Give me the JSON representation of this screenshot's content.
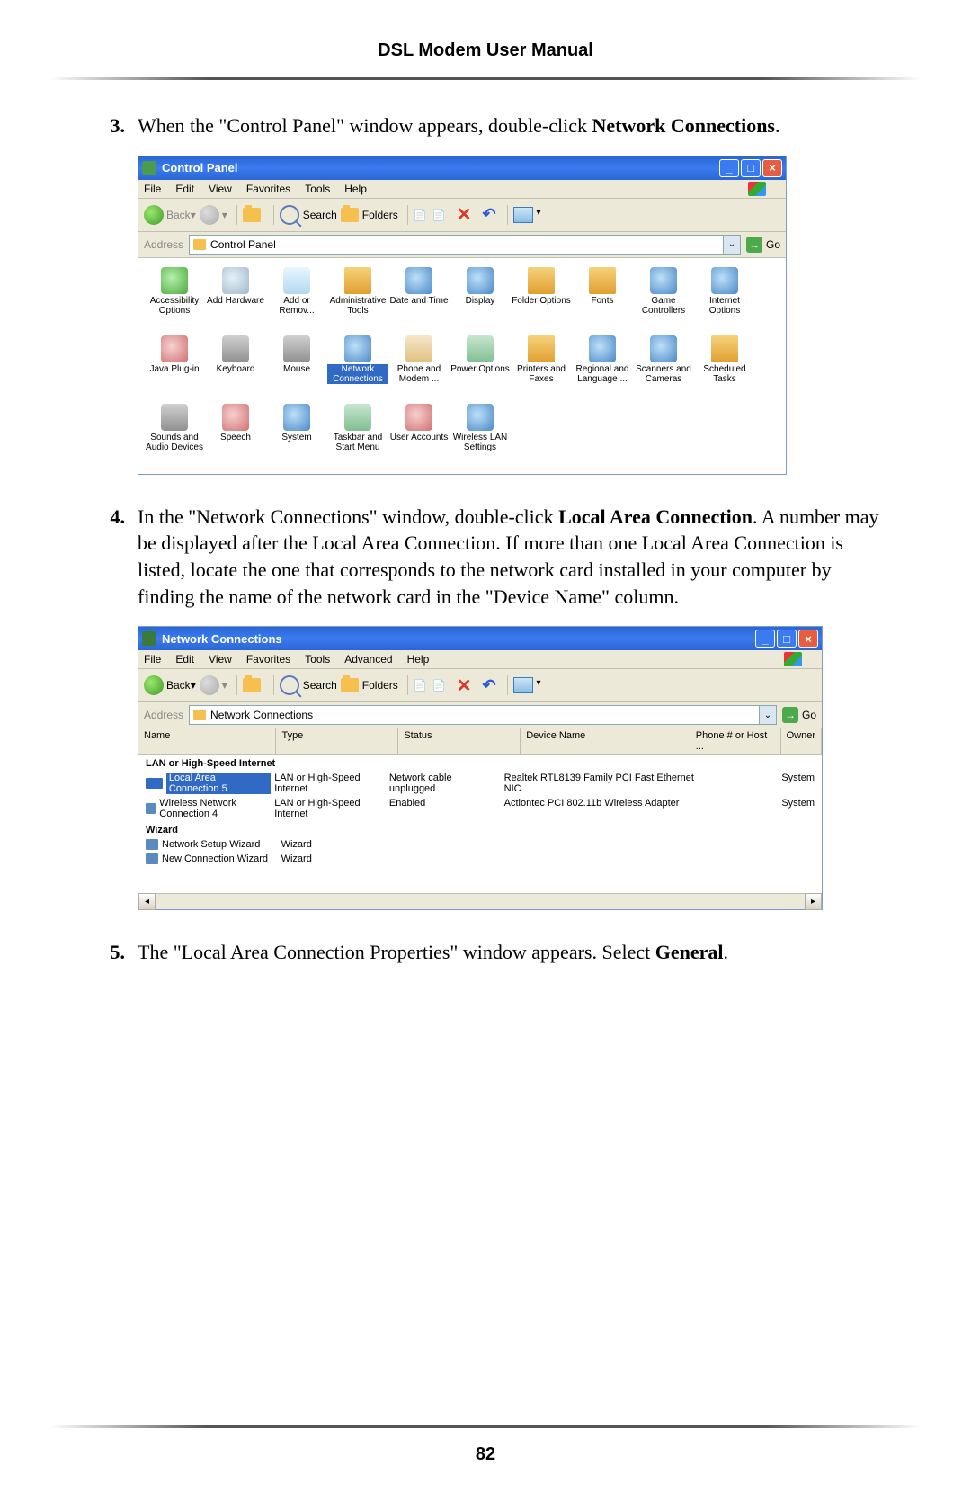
{
  "header": {
    "title": "DSL Modem User Manual"
  },
  "steps": {
    "s3": {
      "num": "3.",
      "pre": "When the \"Control Panel\" window appears, double-click ",
      "bold": "Network Connections",
      "post": "."
    },
    "s4": {
      "num": "4.",
      "pre": "In the \"Network Connections\" window, double-click ",
      "bold": "Local Area Connection",
      "post": ". A number may be displayed after the Local Area Connection. If more than one Local Area Connection is listed, locate the one that corresponds to the network card installed in your computer by finding the name of the network card in the \"Device Name\" column."
    },
    "s5": {
      "num": "5.",
      "pre": "The \"Local Area Connection Properties\" window appears. Select ",
      "bold": "General",
      "post": "."
    }
  },
  "cp": {
    "title": "Control Panel",
    "menu": {
      "file": "File",
      "edit": "Edit",
      "view": "View",
      "fav": "Favorites",
      "tools": "Tools",
      "help": "Help"
    },
    "toolbar": {
      "back": "Back",
      "search": "Search",
      "folders": "Folders"
    },
    "addr": {
      "label": "Address",
      "value": "Control Panel",
      "go": "Go"
    },
    "items": [
      {
        "label": "Accessibility Options",
        "c": "c1"
      },
      {
        "label": "Add Hardware",
        "c": "c2"
      },
      {
        "label": "Add or Remov...",
        "c": "c3"
      },
      {
        "label": "Administrative Tools",
        "c": "c4"
      },
      {
        "label": "Date and Time",
        "c": "c5"
      },
      {
        "label": "Display",
        "c": "c5"
      },
      {
        "label": "Folder Options",
        "c": "c4"
      },
      {
        "label": "Fonts",
        "c": "c4"
      },
      {
        "label": "Game Controllers",
        "c": "c5"
      },
      {
        "label": "Internet Options",
        "c": "c5"
      },
      {
        "label": "Java Plug-in",
        "c": "c8"
      },
      {
        "label": "Keyboard",
        "c": "c6"
      },
      {
        "label": "Mouse",
        "c": "c6"
      },
      {
        "label": "Network Connections",
        "c": "c5",
        "sel": true
      },
      {
        "label": "Phone and Modem ...",
        "c": "c7"
      },
      {
        "label": "Power Options",
        "c": "c9"
      },
      {
        "label": "Printers and Faxes",
        "c": "c4"
      },
      {
        "label": "Regional and Language ...",
        "c": "c5"
      },
      {
        "label": "Scanners and Cameras",
        "c": "c5"
      },
      {
        "label": "Scheduled Tasks",
        "c": "c4"
      },
      {
        "label": "Sounds and Audio Devices",
        "c": "c6"
      },
      {
        "label": "Speech",
        "c": "c8"
      },
      {
        "label": "System",
        "c": "c5"
      },
      {
        "label": "Taskbar and Start Menu",
        "c": "c9"
      },
      {
        "label": "User Accounts",
        "c": "c8"
      },
      {
        "label": "Wireless LAN Settings",
        "c": "c5"
      }
    ]
  },
  "nc": {
    "title": "Network Connections",
    "menu": {
      "file": "File",
      "edit": "Edit",
      "view": "View",
      "fav": "Favorites",
      "tools": "Tools",
      "adv": "Advanced",
      "help": "Help"
    },
    "toolbar": {
      "back": "Back",
      "search": "Search",
      "folders": "Folders"
    },
    "addr": {
      "label": "Address",
      "value": "Network Connections",
      "go": "Go"
    },
    "cols": {
      "name": "Name",
      "type": "Type",
      "status": "Status",
      "dev": "Device Name",
      "phone": "Phone # or Host ...",
      "owner": "Owner"
    },
    "group1": "LAN or High-Speed Internet",
    "rows1": [
      {
        "name": "Local Area Connection 5",
        "type": "LAN or High-Speed Internet",
        "status": "Network cable unplugged",
        "dev": "Realtek RTL8139 Family PCI Fast Ethernet NIC",
        "owner": "System",
        "sel": true
      },
      {
        "name": "Wireless Network Connection 4",
        "type": "LAN or High-Speed Internet",
        "status": "Enabled",
        "dev": "Actiontec PCI 802.11b Wireless Adapter",
        "owner": "System"
      }
    ],
    "group2": "Wizard",
    "rows2": [
      {
        "name": "Network Setup Wizard",
        "type": "Wizard"
      },
      {
        "name": "New Connection Wizard",
        "type": "Wizard"
      }
    ]
  },
  "page_number": "82"
}
